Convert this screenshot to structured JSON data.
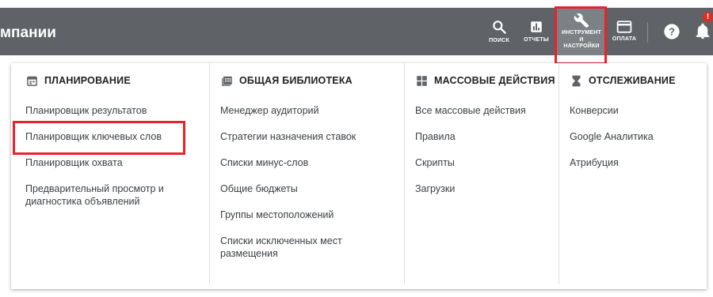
{
  "header": {
    "title": "мпании",
    "tools": [
      {
        "name": "search",
        "label": "ПОИСК",
        "icon": "search-icon"
      },
      {
        "name": "reports",
        "label": "ОТЧЕТЫ",
        "icon": "bar-chart-icon"
      },
      {
        "name": "tools",
        "label_line1": "ИНСТРУМЕНТ",
        "label_line2": "И",
        "label_line3": "НАСТРОЙКИ",
        "icon": "wrench-icon"
      },
      {
        "name": "billing",
        "label": "ОПЛАТА",
        "icon": "credit-card-icon"
      },
      {
        "name": "help",
        "icon": "help-circle-icon"
      },
      {
        "name": "notifications",
        "icon": "bell-icon",
        "badge": "!"
      }
    ]
  },
  "menu": {
    "columns": [
      {
        "heading": "ПЛАНИРОВАНИЕ",
        "icon": "calendar-icon",
        "items": [
          "Планировщик результатов",
          "Планировщик ключевых слов",
          "Планировщик охвата",
          "Предварительный просмотр и диагностика объявлений"
        ]
      },
      {
        "heading": "ОБЩАЯ БИБЛИОТЕКА",
        "icon": "library-icon",
        "items": [
          "Менеджер аудиторий",
          "Стратегии назначения ставок",
          "Списки минус-слов",
          "Общие бюджеты",
          "Группы местоположений",
          "Списки исключенных мест размещения"
        ]
      },
      {
        "heading": "МАССОВЫЕ ДЕЙСТВИЯ",
        "icon": "bulk-actions-icon",
        "items": [
          "Все массовые действия",
          "Правила",
          "Скрипты",
          "Загрузки"
        ]
      },
      {
        "heading": "ОТСЛЕЖИВАНИЕ",
        "icon": "hourglass-icon",
        "items": [
          "Конверсии",
          "Google Аналитика",
          "Атрибуция"
        ]
      }
    ]
  },
  "colors": {
    "header_bg": "#5f6368",
    "highlight": "#e8232b",
    "badge": "#d93025"
  }
}
